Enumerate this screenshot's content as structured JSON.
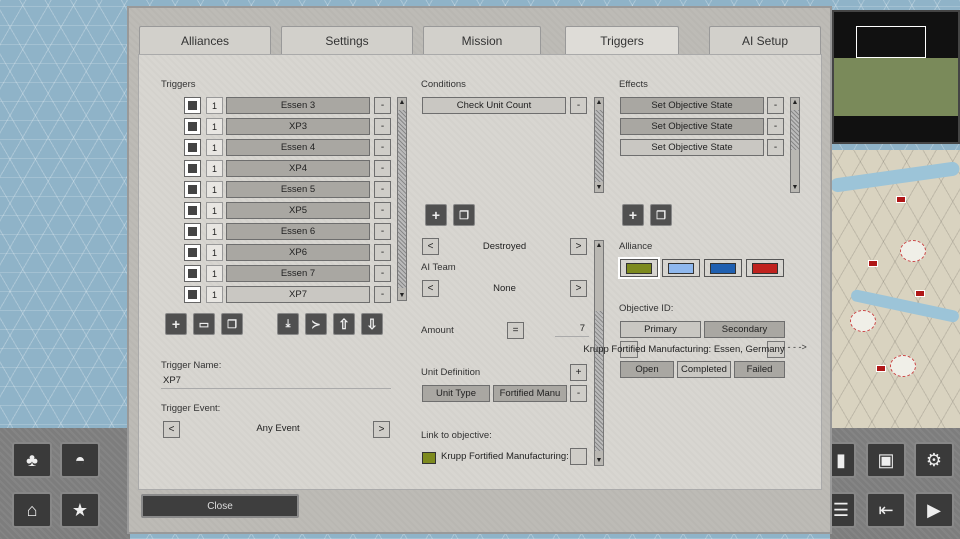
{
  "tabs": [
    {
      "label": "Alliances"
    },
    {
      "label": "Settings"
    },
    {
      "label": "Mission"
    },
    {
      "label": "Triggers"
    },
    {
      "label": "AI Setup"
    }
  ],
  "triggers": {
    "heading": "Triggers",
    "items": [
      {
        "count": "1",
        "name": "Essen 3",
        "remove": "-"
      },
      {
        "count": "1",
        "name": "XP3",
        "remove": "-"
      },
      {
        "count": "1",
        "name": "Essen 4",
        "remove": "-"
      },
      {
        "count": "1",
        "name": "XP4",
        "remove": "-"
      },
      {
        "count": "1",
        "name": "Essen 5",
        "remove": "-"
      },
      {
        "count": "1",
        "name": "XP5",
        "remove": "-"
      },
      {
        "count": "1",
        "name": "Essen 6",
        "remove": "-"
      },
      {
        "count": "1",
        "name": "XP6",
        "remove": "-"
      },
      {
        "count": "1",
        "name": "Essen 7",
        "remove": "-"
      },
      {
        "count": "1",
        "name": "XP7",
        "remove": "-"
      }
    ],
    "name_label": "Trigger Name:",
    "name_value": "XP7",
    "event_label": "Trigger Event:",
    "event_value": "Any Event",
    "prev": "<",
    "next": ">"
  },
  "conditions": {
    "heading": "Conditions",
    "items": [
      {
        "name": "Check Unit Count",
        "remove": "-"
      }
    ],
    "state_value": "Destroyed",
    "ai_team_label": "AI Team",
    "ai_team_value": "None",
    "amount_label": "Amount",
    "amount_op": "=",
    "amount_value": "7",
    "unit_def_label": "Unit Definition",
    "unit_def_add": "+",
    "unit_def_remove": "-",
    "unit_type": "Unit Type",
    "unit_name": "Fortified Manu",
    "link_label": "Link to objective:",
    "link_value": "Krupp Fortified Manufacturing: Es",
    "link_color": "#7d8a1e",
    "prev": "<",
    "next": ">"
  },
  "effects": {
    "heading": "Effects",
    "items": [
      {
        "name": "Set Objective State",
        "remove": "-"
      },
      {
        "name": "Set Objective State",
        "remove": "-"
      },
      {
        "name": "Set Objective State",
        "remove": "-"
      }
    ],
    "alliance_label": "Alliance",
    "alliance_colors": [
      "#7d8a1e",
      "#8fb8ee",
      "#1f5fb0",
      "#c0221e"
    ],
    "objective_label": "Objective ID:",
    "primary": "Primary",
    "secondary": "Secondary",
    "objective_value": "Krupp Fortified Manufacturing: Essen, Germany",
    "objective_arrow": "- - - ->",
    "open": "Open",
    "completed": "Completed",
    "failed": "Failed"
  },
  "footer": {
    "close": "Close"
  },
  "icons": {
    "add": "+",
    "up": "⇧",
    "down": "⇩"
  }
}
